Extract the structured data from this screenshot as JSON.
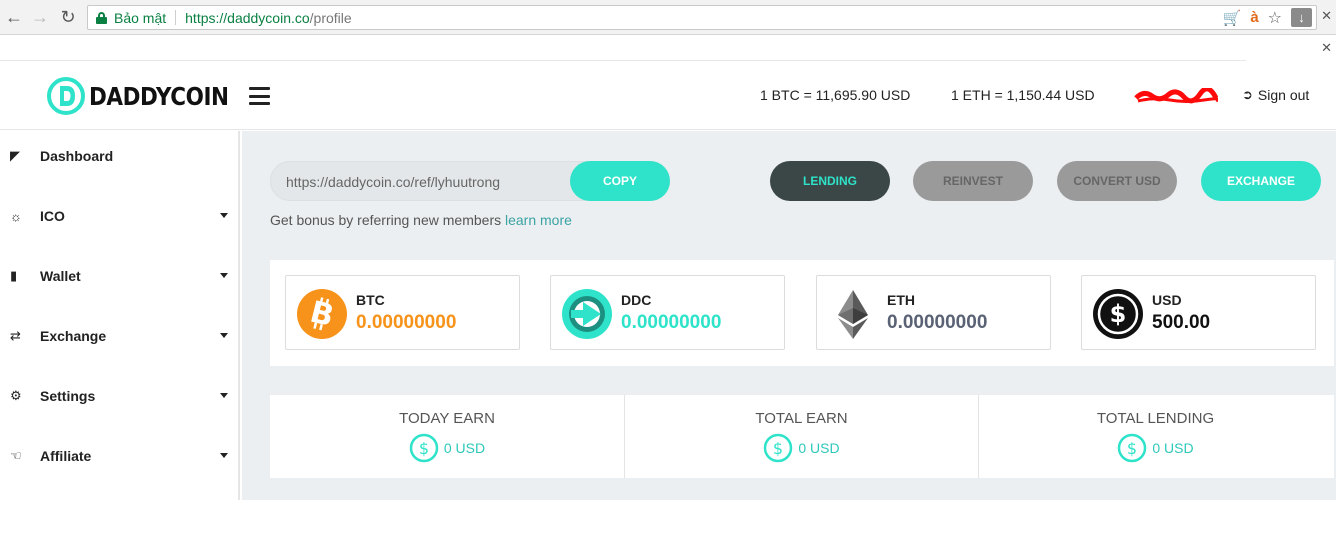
{
  "browser": {
    "secure_label": "Bảo mật",
    "url_host": "https://daddycoin.co",
    "url_path": "/profile"
  },
  "header": {
    "logo_text": "DADDYCOIN",
    "btc_rate": "1 BTC = 11,695.90 USD",
    "eth_rate": "1 ETH = 1,150.44 USD",
    "signout_label": "Sign out"
  },
  "sidebar": {
    "items": [
      {
        "label": "Dashboard",
        "icon": "dashboard-icon",
        "has_submenu": false
      },
      {
        "label": "ICO",
        "icon": "spinner-icon",
        "has_submenu": true
      },
      {
        "label": "Wallet",
        "icon": "wallet-icon",
        "has_submenu": true
      },
      {
        "label": "Exchange",
        "icon": "shuffle-icon",
        "has_submenu": true
      },
      {
        "label": "Settings",
        "icon": "gear-icon",
        "has_submenu": true
      },
      {
        "label": "Affiliate",
        "icon": "handshake-icon",
        "has_submenu": true
      }
    ]
  },
  "referral": {
    "url": "https://daddycoin.co/ref/lyhuutrong",
    "copy_label": "COPY",
    "hint": "Get bonus by referring new members ",
    "learn_more": "learn more"
  },
  "actions": {
    "lending": "LENDING",
    "reinvest": "REINVEST",
    "convert_usd": "CONVERT USD",
    "exchange": "EXCHANGE"
  },
  "balances": [
    {
      "name": "BTC",
      "value": "0.00000000",
      "color": "#f7931a"
    },
    {
      "name": "DDC",
      "value": "0.00000000",
      "color": "#2ee3c9"
    },
    {
      "name": "ETH",
      "value": "0.00000000",
      "color": "#5a6275"
    },
    {
      "name": "USD",
      "value": "500.00",
      "color": "#111111"
    }
  ],
  "earnings": [
    {
      "title": "TODAY EARN",
      "value": "0 USD"
    },
    {
      "title": "TOTAL EARN",
      "value": "0 USD"
    },
    {
      "title": "TOTAL LENDING",
      "value": "0 USD"
    }
  ],
  "colors": {
    "accent": "#2ee3c9",
    "dark_button": "#3b4646",
    "disabled_button": "#9a9a9a",
    "secure_green": "#0b8043"
  }
}
